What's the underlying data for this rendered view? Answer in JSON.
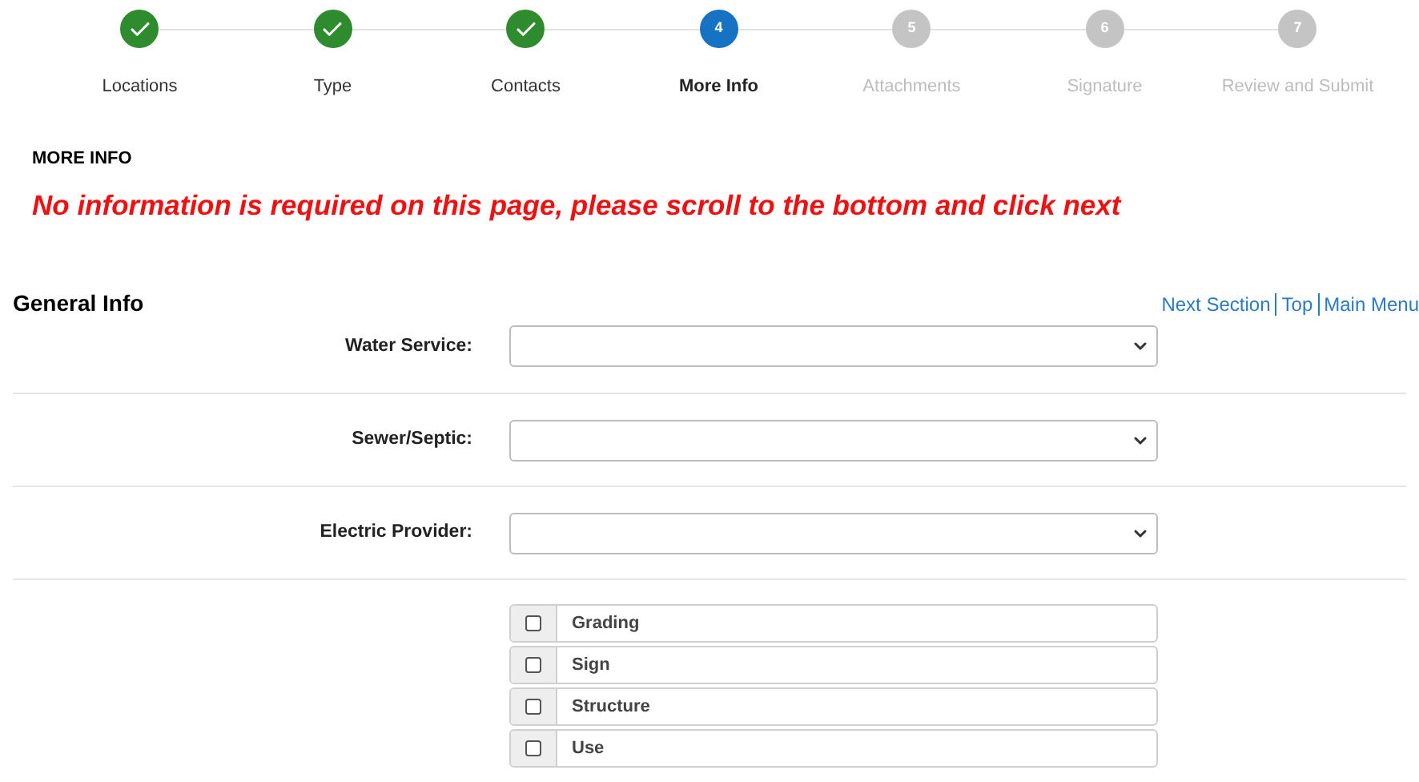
{
  "steps": [
    {
      "label": "Locations",
      "kind": "done"
    },
    {
      "label": "Type",
      "kind": "done"
    },
    {
      "label": "Contacts",
      "kind": "done"
    },
    {
      "label": "More Info",
      "number": "4",
      "kind": "current"
    },
    {
      "label": "Attachments",
      "number": "5",
      "kind": "upcoming"
    },
    {
      "label": "Signature",
      "number": "6",
      "kind": "upcoming"
    },
    {
      "label": "Review and Submit",
      "number": "7",
      "kind": "upcoming"
    }
  ],
  "page_title": "MORE INFO",
  "notice": "No information is required on this page, please scroll to the bottom and click next",
  "section": {
    "title": "General Info",
    "links": [
      "Next Section",
      "Top",
      "Main Menu"
    ]
  },
  "fields": [
    {
      "label": "Water Service:"
    },
    {
      "label": "Sewer/Septic:"
    },
    {
      "label": "Electric Provider:"
    }
  ],
  "checkboxes": [
    {
      "label": "Grading",
      "checked": false
    },
    {
      "label": "Sign",
      "checked": false
    },
    {
      "label": "Structure",
      "checked": false
    },
    {
      "label": "Use",
      "checked": false
    }
  ]
}
